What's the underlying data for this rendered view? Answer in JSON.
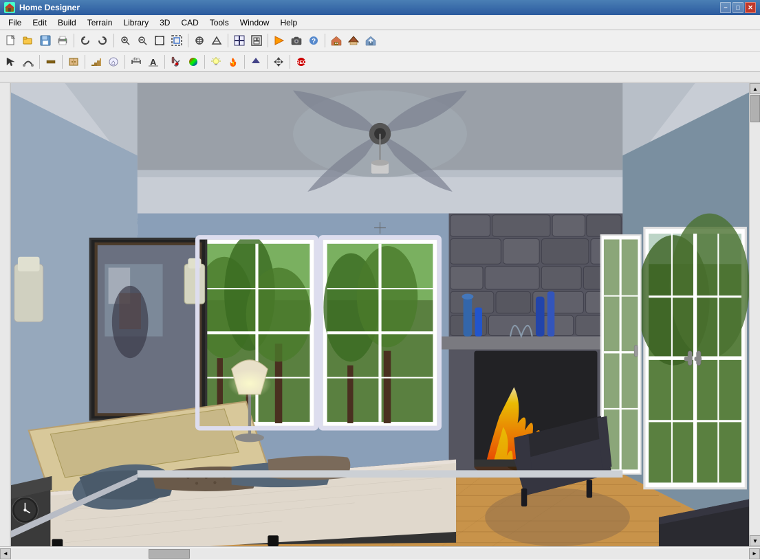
{
  "window": {
    "title": "Home Designer",
    "icon": "HD"
  },
  "titlebar": {
    "minimize_label": "−",
    "maximize_label": "□",
    "close_label": "✕"
  },
  "menubar": {
    "items": [
      {
        "id": "file",
        "label": "File"
      },
      {
        "id": "edit",
        "label": "Edit"
      },
      {
        "id": "build",
        "label": "Build"
      },
      {
        "id": "terrain",
        "label": "Terrain"
      },
      {
        "id": "library",
        "label": "Library"
      },
      {
        "id": "3d",
        "label": "3D"
      },
      {
        "id": "cad",
        "label": "CAD"
      },
      {
        "id": "tools",
        "label": "Tools"
      },
      {
        "id": "window",
        "label": "Window"
      },
      {
        "id": "help",
        "label": "Help"
      }
    ]
  },
  "toolbar1": {
    "buttons": [
      {
        "id": "new",
        "icon": "new-file-icon",
        "tooltip": "New"
      },
      {
        "id": "open",
        "icon": "open-icon",
        "tooltip": "Open"
      },
      {
        "id": "save",
        "icon": "save-icon",
        "tooltip": "Save"
      },
      {
        "id": "print",
        "icon": "print-icon",
        "tooltip": "Print"
      },
      {
        "id": "undo",
        "icon": "undo-icon",
        "tooltip": "Undo"
      },
      {
        "id": "redo",
        "icon": "redo-icon",
        "tooltip": "Redo"
      },
      {
        "id": "zoom-in",
        "icon": "zoom-in-icon",
        "tooltip": "Zoom In"
      },
      {
        "id": "zoom-out",
        "icon": "zoom-out-icon",
        "tooltip": "Zoom Out"
      },
      {
        "id": "fill-window",
        "icon": "fill-window-icon",
        "tooltip": "Fill Window"
      },
      {
        "id": "zoom-box",
        "icon": "zoom-box-icon",
        "tooltip": "Zoom Box"
      }
    ]
  },
  "scene": {
    "description": "3D bedroom interior view with fireplace, bed, and french doors"
  },
  "statusbar": {
    "text": ""
  }
}
